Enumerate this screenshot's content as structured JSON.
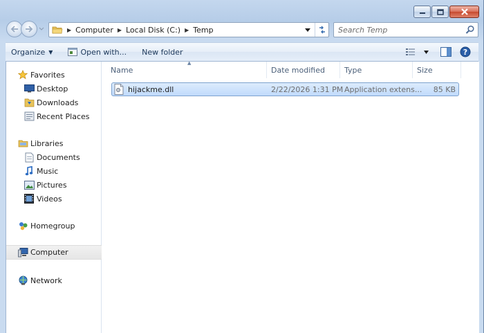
{
  "address": {
    "crumbs": [
      "Computer",
      "Local Disk (C:)",
      "Temp"
    ]
  },
  "search": {
    "placeholder": "Search Temp"
  },
  "toolbar": {
    "organize_label": "Organize",
    "open_with_label": "Open with...",
    "new_folder_label": "New folder"
  },
  "nav": {
    "favorites": {
      "label": "Favorites",
      "items": [
        {
          "label": "Desktop",
          "icon": "desktop-icon"
        },
        {
          "label": "Downloads",
          "icon": "downloads-icon"
        },
        {
          "label": "Recent Places",
          "icon": "recent-places-icon"
        }
      ]
    },
    "libraries": {
      "label": "Libraries",
      "items": [
        {
          "label": "Documents",
          "icon": "documents-icon"
        },
        {
          "label": "Music",
          "icon": "music-icon"
        },
        {
          "label": "Pictures",
          "icon": "pictures-icon"
        },
        {
          "label": "Videos",
          "icon": "videos-icon"
        }
      ]
    },
    "homegroup": {
      "label": "Homegroup"
    },
    "computer": {
      "label": "Computer",
      "selected": true
    },
    "network": {
      "label": "Network"
    }
  },
  "columns": {
    "name": "Name",
    "date_modified": "Date modified",
    "type": "Type",
    "size": "Size"
  },
  "files": [
    {
      "name": "hijackme.dll",
      "date_modified": "2/22/2026 1:31 PM",
      "type": "Application extens...",
      "size": "85 KB",
      "selected": true
    }
  ],
  "colors": {
    "selection_border": "#7da2ce",
    "selection_fill": "#c1dbfc",
    "toolbar_text": "#1e395b",
    "close_button": "#c74a2f"
  }
}
